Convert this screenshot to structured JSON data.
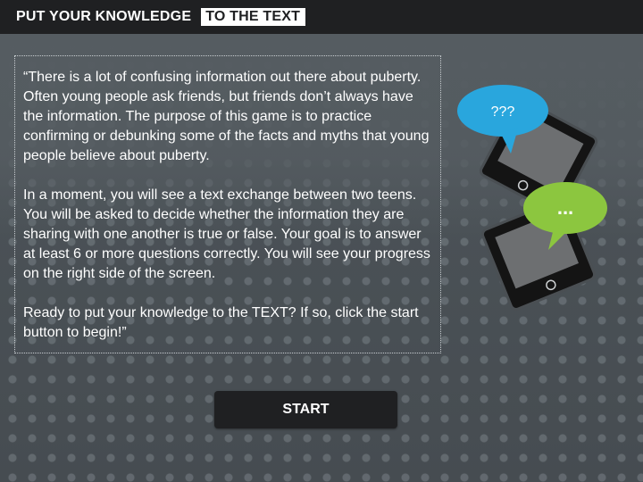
{
  "header": {
    "title_part1": "PUT YOUR KNOWLEDGE",
    "title_part2": "TO THE TEXT"
  },
  "intro": {
    "paragraphs": [
      "“There is a lot of confusing information out there about puberty. Often young people ask friends, but friends don’t always have the information. The purpose of this game is to practice confirming or debunking some of the facts and myths that young people believe about puberty.",
      "In a moment, you will see a text exchange between two teens. You will be asked to decide whether the information they are sharing with one another is true or false. Your goal is to answer at least 6 or more questions correctly. You will see your progress on the right side of the screen.",
      "Ready to put your knowledge to the TEXT? If so, click the start button to begin!”"
    ]
  },
  "illustration": {
    "bubble_question_text": "???",
    "bubble_dots_text": "...",
    "bubble_question_color": "#29a6dd",
    "bubble_dots_color": "#8cc63f",
    "icons": [
      "phone-icon",
      "phone-icon",
      "speech-bubble-icon",
      "speech-bubble-icon"
    ]
  },
  "start_button": {
    "label": "START"
  },
  "colors": {
    "header_bg": "#1f2022",
    "background": "#4b5257",
    "text": "#ffffff"
  }
}
